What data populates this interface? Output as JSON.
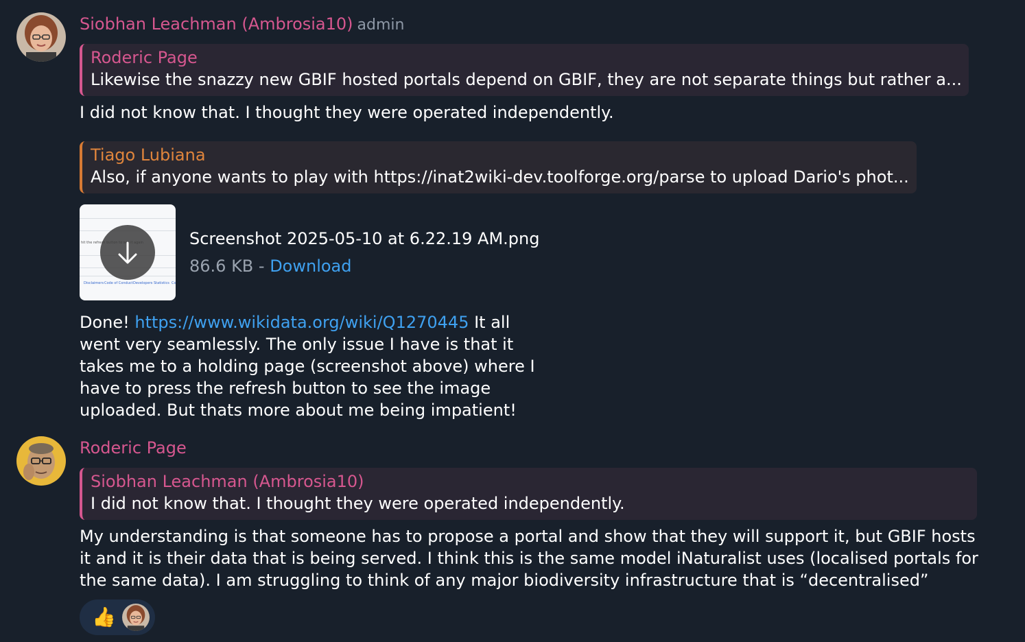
{
  "messages": [
    {
      "author": "Siobhan Leachman (Ambrosia10)",
      "role": "admin",
      "avatar_icon": "user-avatar-siobhan",
      "blocks": [
        {
          "reply_to": "Roderic Page",
          "reply_text": "Likewise the snazzy new GBIF hosted portals depend on GBIF, they are not separate things but rather a..."
        },
        {
          "text": "I did not know that. I thought they were operated independently."
        },
        {
          "reply_to": "Tiago Lubiana",
          "reply_text": "Also, if anyone wants to play with https://inat2wiki-dev.toolforge.org/parse to upload Dario's phot..."
        },
        {
          "file_name": "Screenshot 2025-05-10 at 6.22.19 AM.png",
          "file_size": "86.6 KB",
          "separator": " - ",
          "download_label": "Download",
          "thumb_text_1": "hit the refresh button to see it again",
          "thumb_footer": [
            "Disclaimers",
            "Code of Conduct",
            "Developers",
            "Statistics",
            "Co"
          ]
        },
        {
          "prefix": "Done! ",
          "link": "https://www.wikidata.org/wiki/Q1270445",
          "lines": [
            " It all",
            "went very seamlessly. The only issue I have is that it",
            "takes me to a holding page (screenshot above) where I",
            "have to press the refresh button to see the image",
            "uploaded. But thats more about me being impatient!"
          ]
        }
      ]
    },
    {
      "author": "Roderic Page",
      "avatar_icon": "user-avatar-roderic",
      "blocks": [
        {
          "reply_to": "Siobhan Leachman (Ambrosia10)",
          "reply_text": "I did not know that. I thought they were operated independently."
        },
        {
          "lines": [
            "My understanding is that someone has to propose a portal and show that they will support it, but GBIF hosts",
            "it and it is their data that is being served. I think this is the same model iNaturalist uses (localised portals for",
            "the same data). I am struggling to think of any major biodiversity infrastructure that is “decentralised”"
          ]
        },
        {
          "reaction_emoji": "👍",
          "reaction_user_icon": "user-avatar-siobhan"
        }
      ]
    }
  ],
  "colors": {
    "background": "#18202b",
    "author_pink": "#d6578f",
    "author_orange": "#e0853c",
    "link_blue": "#3fa1f0",
    "reply_bg": "#2a2633",
    "reaction_bg": "#1f2e44"
  }
}
